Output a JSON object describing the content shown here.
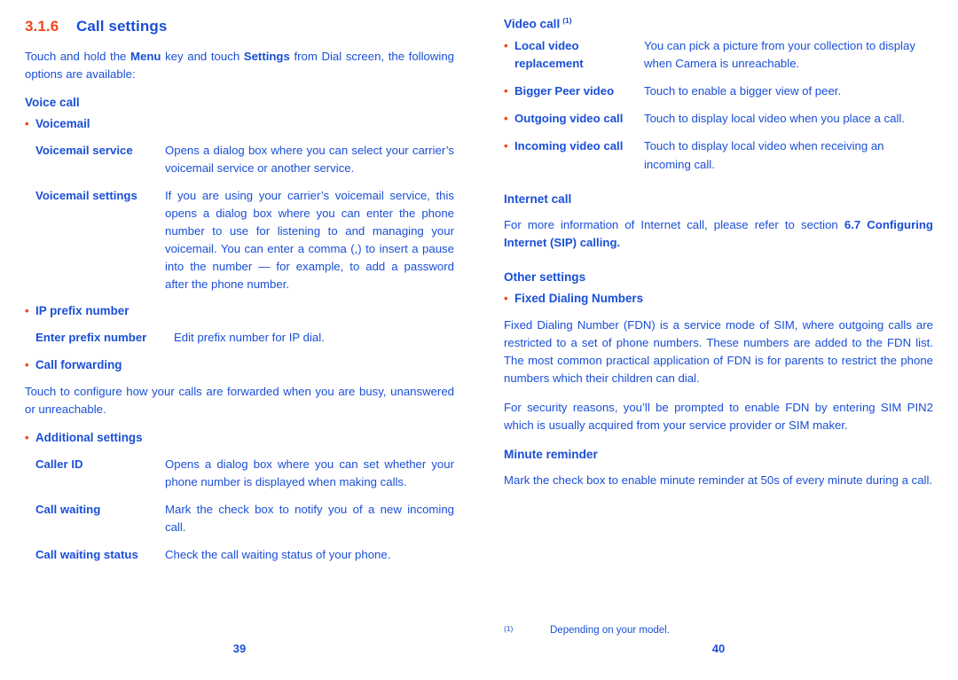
{
  "document": {
    "left_page": {
      "page_number": "39",
      "section": {
        "number": "3.1.6",
        "title": "Call settings"
      },
      "intro": {
        "part1": "Touch and hold the ",
        "bold1": "Menu",
        "part2": " key and touch ",
        "bold2": "Settings",
        "part3": " from Dial screen, the following options are available:"
      },
      "voice_call_heading": "Voice call",
      "voicemail_bullet": "Voicemail",
      "voicemail_defs": [
        {
          "term": "Voicemail service",
          "desc": "Opens a dialog box where you can select your carrier’s voicemail service or another service."
        },
        {
          "term": "Voicemail settings",
          "desc": "If you are using your carrier’s voicemail service, this opens a dialog box where you can enter the phone number to use for listening to and managing your voicemail. You can enter a comma (,) to insert a pause into the number — for example, to add a password after the phone number."
        }
      ],
      "ip_prefix_bullet": "IP prefix number",
      "ip_prefix_defs": [
        {
          "term": "Enter prefix number",
          "desc": "Edit prefix number for IP dial."
        }
      ],
      "call_forwarding_bullet": "Call forwarding",
      "call_forwarding_text": "Touch to configure how your calls are forwarded when you are busy, unanswered or unreachable.",
      "additional_settings_bullet": "Additional settings",
      "additional_defs": [
        {
          "term": "Caller ID",
          "desc": "Opens a dialog box where you can set whether your phone number is displayed when making calls."
        },
        {
          "term": "Call waiting",
          "desc": "Mark the check box to notify you of a new incoming call."
        },
        {
          "term": "Call waiting status",
          "desc": "Check the call waiting status of your phone."
        }
      ]
    },
    "right_page": {
      "page_number": "40",
      "video_call_heading": "Video call",
      "video_call_superscript": "(1)",
      "video_call_defs": [
        {
          "term": "Local video replacement",
          "desc": "You can pick a picture from your collection to display when Camera is unreachable."
        },
        {
          "term": "Bigger Peer video",
          "desc": "Touch to enable a bigger view of peer."
        },
        {
          "term": "Outgoing video call",
          "desc": "Touch to display local video when you place a call."
        },
        {
          "term": "Incoming video call",
          "desc": "Touch to display local video when receiving an incoming call."
        }
      ],
      "internet_call_heading": "Internet call",
      "internet_call_text": {
        "part1": "For more information of Internet call, please refer to section ",
        "bold1": "6.7 Configuring Internet (SIP) calling."
      },
      "other_settings_heading": "Other settings",
      "fdn_bullet": "Fixed Dialing Numbers",
      "fdn_paragraph1": "Fixed Dialing Number (FDN) is a service mode of SIM, where outgoing calls are restricted to a set of phone numbers. These numbers are added to the FDN list. The most common practical application of FDN is for parents to restrict the phone numbers which their children can dial.",
      "fdn_paragraph2": "For security reasons, you’ll be prompted to enable FDN by entering SIM PIN2 which is usually acquired from your service provider or SIM maker.",
      "minute_reminder_heading": "Minute reminder",
      "minute_reminder_text": "Mark the check box to enable minute reminder at 50s of every minute during a call.",
      "footnote": {
        "marker": "(1)",
        "text": "Depending on your model."
      }
    }
  },
  "colors": {
    "heading_blue": "#1a4fd6",
    "accent_orange": "#f0481f",
    "page_background": "#ffffff"
  }
}
